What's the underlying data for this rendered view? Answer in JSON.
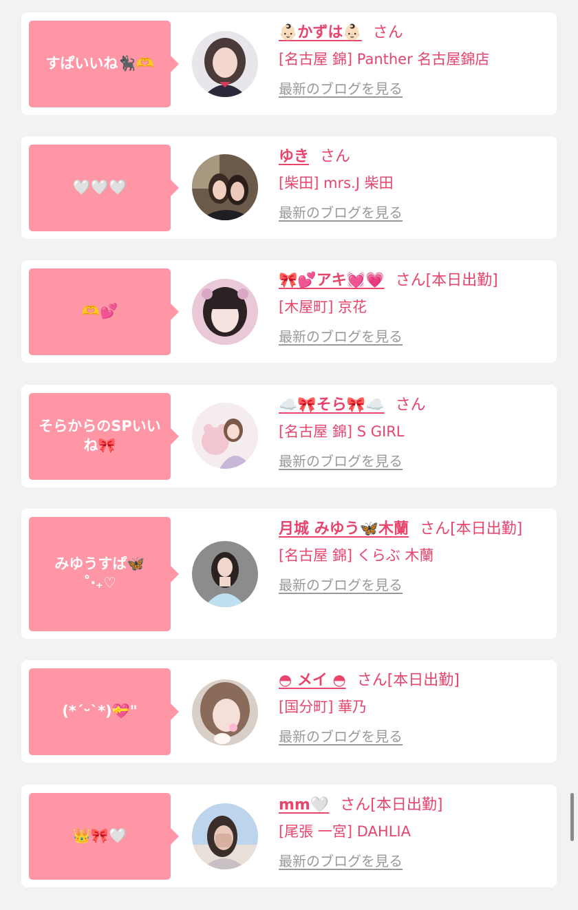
{
  "colors": {
    "page_background": "#f2f2f2",
    "card_background": "#ffffff",
    "bubble_pink": "#ff96a6",
    "accent_pink": "#e8446c",
    "link_gray": "#999999"
  },
  "posts": [
    {
      "message": "すぱいいね🐈‍⬛🫶",
      "name": "👶🏻かずは👶🏻",
      "suffix": "さん",
      "shop": "[名古屋 錦] Panther 名古屋錦店",
      "blog_link": "最新のブログを見る",
      "avatar_icon": "girl-photo-avatar"
    },
    {
      "message": "🤍🤍🤍",
      "name": "ゆき",
      "suffix": "さん",
      "shop": "[柴田] mrs.J 柴田",
      "blog_link": "最新のブログを見る",
      "avatar_icon": "girl-photo-avatar"
    },
    {
      "message": "🫶💕",
      "name": "🎀💕アキ💓💗",
      "suffix": "さん[本日出勤]",
      "shop": "[木屋町] 京花",
      "blog_link": "最新のブログを見る",
      "avatar_icon": "girl-photo-avatar"
    },
    {
      "message": "そらからのSPいいね🎀",
      "name": "☁️🎀そら🎀☁️",
      "suffix": "さん",
      "shop": "[名古屋 錦] S GIRL",
      "blog_link": "最新のブログを見る",
      "avatar_icon": "girl-photo-avatar"
    },
    {
      "message": "みゆうすぱ🦋\n˚‧₊♡",
      "name": "月城 みゆう🦋木蘭",
      "suffix": "さん[本日出勤]",
      "shop": "[名古屋 錦] くらぶ 木蘭",
      "blog_link": "最新のブログを見る",
      "avatar_icon": "girl-photo-avatar"
    },
    {
      "message": "(*ˊᵕˋ*)💝\"",
      "name": "◓ メイ ◓",
      "suffix": "さん[本日出勤]",
      "shop": "[国分町] 華乃",
      "blog_link": "最新のブログを見る",
      "avatar_icon": "girl-photo-avatar"
    },
    {
      "message": "👑🎀🤍",
      "name": "mm🤍",
      "suffix": "さん[本日出勤]",
      "shop": "[尾張 一宮] DAHLIA",
      "blog_link": "最新のブログを見る",
      "avatar_icon": "girl-photo-avatar"
    }
  ]
}
